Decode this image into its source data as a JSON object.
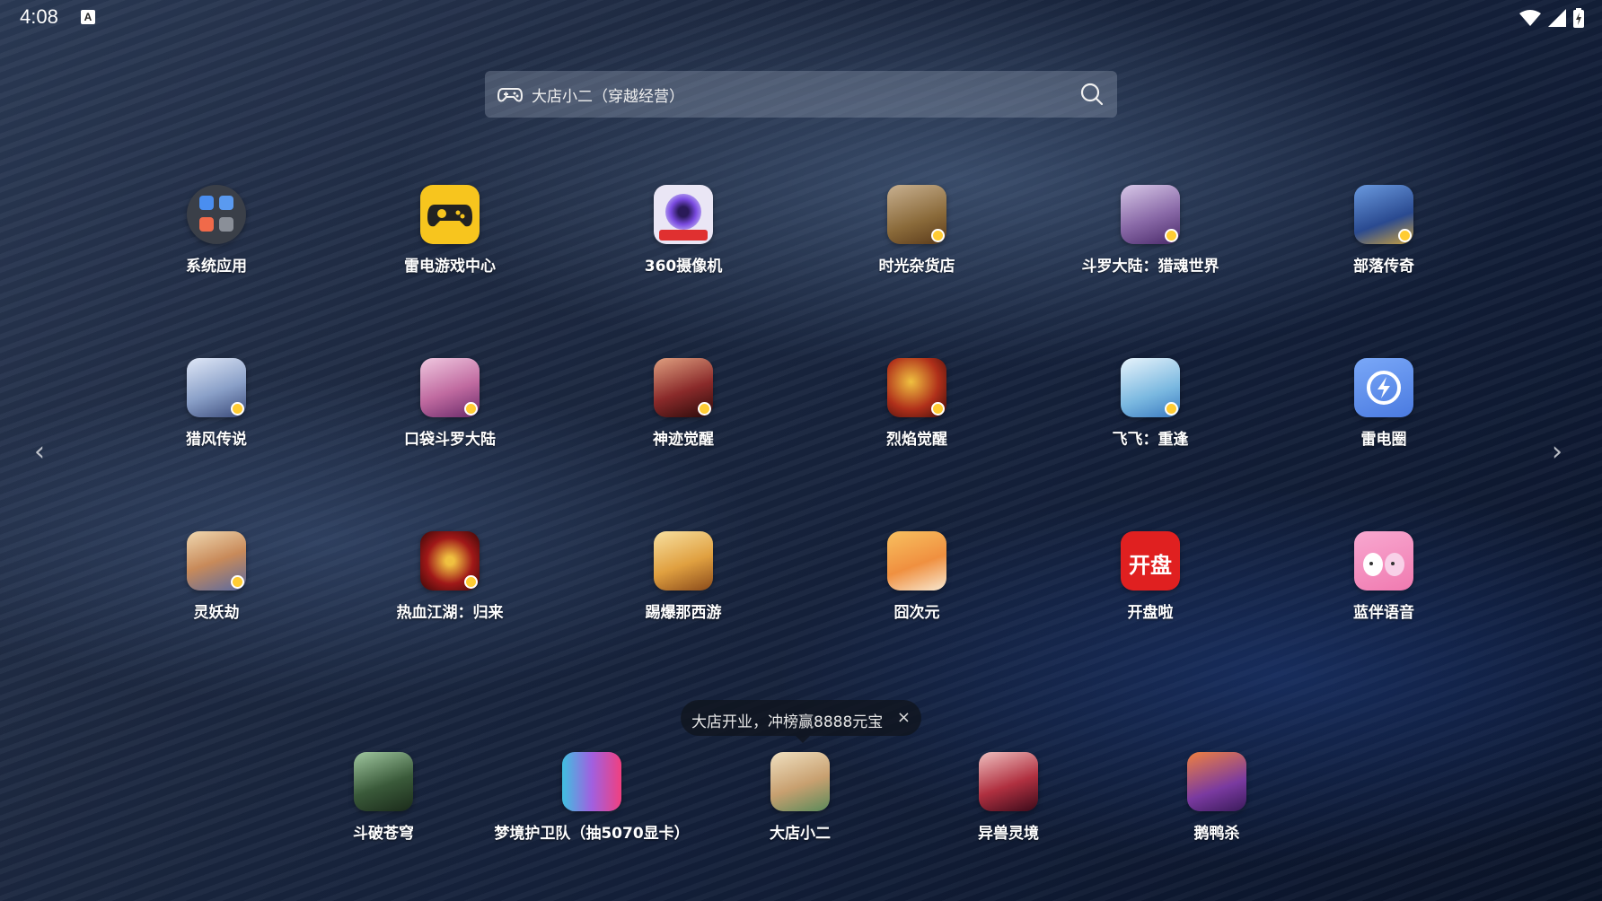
{
  "status": {
    "time": "4:08",
    "badge": "A"
  },
  "search": {
    "text": "大店小二（穿越经营）"
  },
  "apps": [
    {
      "label": "系统应用",
      "icon": "system-apps-icon",
      "color": "#3a3f48"
    },
    {
      "label": "雷电游戏中心",
      "icon": "game-center-icon",
      "color": "#f7c51e"
    },
    {
      "label": "360摄像机",
      "icon": "camera-icon",
      "color": "#eae6f5"
    },
    {
      "label": "时光杂货店",
      "icon": "game-icon",
      "color": "#8a6a3a"
    },
    {
      "label": "斗罗大陆：猎魂世界",
      "icon": "game-icon",
      "color": "#8a6aa8"
    },
    {
      "label": "部落传奇",
      "icon": "game-icon",
      "color": "#3a66b0"
    },
    {
      "label": "猎风传说",
      "icon": "game-icon",
      "color": "#8aa0c8"
    },
    {
      "label": "口袋斗罗大陆",
      "icon": "game-icon",
      "color": "#c06aa0"
    },
    {
      "label": "神迹觉醒",
      "icon": "game-icon",
      "color": "#8a2a2a"
    },
    {
      "label": "烈焰觉醒",
      "icon": "game-icon",
      "color": "#b0301a"
    },
    {
      "label": "飞飞：重逢",
      "icon": "game-icon",
      "color": "#7ab8e0"
    },
    {
      "label": "雷电圈",
      "icon": "lightning-circle-icon",
      "color": "#5b8ef0"
    },
    {
      "label": "灵妖劫",
      "icon": "game-icon",
      "color": "#c88a5a"
    },
    {
      "label": "热血江湖：归来",
      "icon": "game-icon",
      "color": "#a01818"
    },
    {
      "label": "踢爆那西游",
      "icon": "game-icon",
      "color": "#e0a040"
    },
    {
      "label": "囧次元",
      "icon": "game-icon",
      "color": "#f09040"
    },
    {
      "label": "开盘啦",
      "icon": "kaipan-icon",
      "color": "#e02020"
    },
    {
      "label": "蓝伴语音",
      "icon": "voice-icon",
      "color": "#f07ab0"
    }
  ],
  "dock": [
    {
      "label": "斗破苍穹",
      "icon": "game-icon",
      "color": "#3a5a3a"
    },
    {
      "label": "梦境护卫队（抽5070显卡）",
      "icon": "game-icon",
      "color": "#a060e0"
    },
    {
      "label": "大店小二",
      "icon": "game-icon",
      "color": "#c8a070"
    },
    {
      "label": "异兽灵境",
      "icon": "game-icon",
      "color": "#b03040"
    },
    {
      "label": "鹅鸭杀",
      "icon": "game-icon",
      "color": "#7a3aa0"
    }
  ],
  "toast": {
    "text": "大店开业，冲榜赢8888元宝",
    "close": "×"
  },
  "nav": {
    "left": "‹",
    "right": "›"
  },
  "icon_text": {
    "kaipan": "开盘"
  }
}
